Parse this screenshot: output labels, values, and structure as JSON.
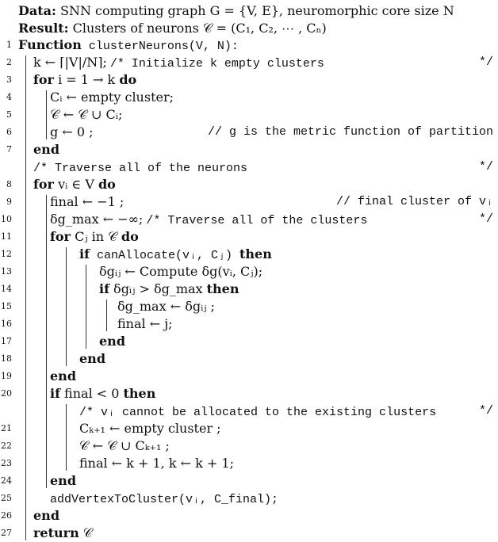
{
  "algorithm": {
    "data_label": "Data:",
    "data_text": "SNN computing graph G = {V, E}, neuromorphic core size N",
    "result_label": "Result:",
    "result_text": "Clusters of neurons 𝒞 = (C₁, C₂, ⋯ , Cₙ)",
    "lines": [
      {
        "num": "1",
        "kw": "Function",
        "text": " clusterNeurons(V, N):"
      },
      {
        "num": "2",
        "text": "k ← ⌈|V|/N⌉;",
        "comment": "/* Initialize k empty clusters",
        "rcomment": "*/"
      },
      {
        "num": "3",
        "kw": "for",
        "text": " i = 1 → k ",
        "kw2": "do"
      },
      {
        "num": "4",
        "text": "Cᵢ ← empty cluster;"
      },
      {
        "num": "5",
        "text": "𝒞 ← 𝒞 ∪ Cᵢ;"
      },
      {
        "num": "6",
        "text": "g ← 0 ;",
        "comment": "// g is the metric function of partition"
      },
      {
        "num": "7",
        "kw": "end"
      },
      {
        "num": "",
        "comment": "/* Traverse all of the neurons",
        "rcomment": "*/"
      },
      {
        "num": "8",
        "kw": "for",
        "text": " vᵢ ∈ V ",
        "kw2": "do"
      },
      {
        "num": "9",
        "text": "final ← −1 ;",
        "comment": "// final cluster of vᵢ"
      },
      {
        "num": "10",
        "text": "δg_max ← −∞;",
        "comment": "/* Traverse all of the clusters",
        "rcomment": "*/"
      },
      {
        "num": "11",
        "kw": "for",
        "text": " Cⱼ in 𝒞 ",
        "kw2": "do"
      },
      {
        "num": "12",
        "kw": "if",
        "text": " canAllocate(vᵢ, Cⱼ) ",
        "kw2": "then"
      },
      {
        "num": "13",
        "text": "δgᵢⱼ ← Compute δg(vᵢ, Cⱼ);"
      },
      {
        "num": "14",
        "kw": "if",
        "text": " δgᵢⱼ > δg_max ",
        "kw2": "then"
      },
      {
        "num": "15",
        "text": "δg_max ← δgᵢⱼ ;"
      },
      {
        "num": "16",
        "text": "final ← j;"
      },
      {
        "num": "17",
        "kw": "end"
      },
      {
        "num": "18",
        "kw": "end"
      },
      {
        "num": "19",
        "kw": "end"
      },
      {
        "num": "20",
        "kw": "if",
        "text": " final < 0 ",
        "kw2": "then"
      },
      {
        "num": "",
        "comment": "/* vᵢ cannot be allocated to the existing clusters",
        "rcomment": "*/"
      },
      {
        "num": "21",
        "text": "Cₖ₊₁ ← empty cluster ;"
      },
      {
        "num": "22",
        "text": "𝒞 ← 𝒞 ∪ Cₖ₊₁ ;"
      },
      {
        "num": "23",
        "text": "final ← k + 1, k ← k + 1;"
      },
      {
        "num": "24",
        "kw": "end"
      },
      {
        "num": "25",
        "text": "addVertexToCluster(vᵢ, C_final);"
      },
      {
        "num": "26",
        "kw": "end"
      },
      {
        "num": "27",
        "kw": "return",
        "text": " 𝒞"
      }
    ]
  }
}
